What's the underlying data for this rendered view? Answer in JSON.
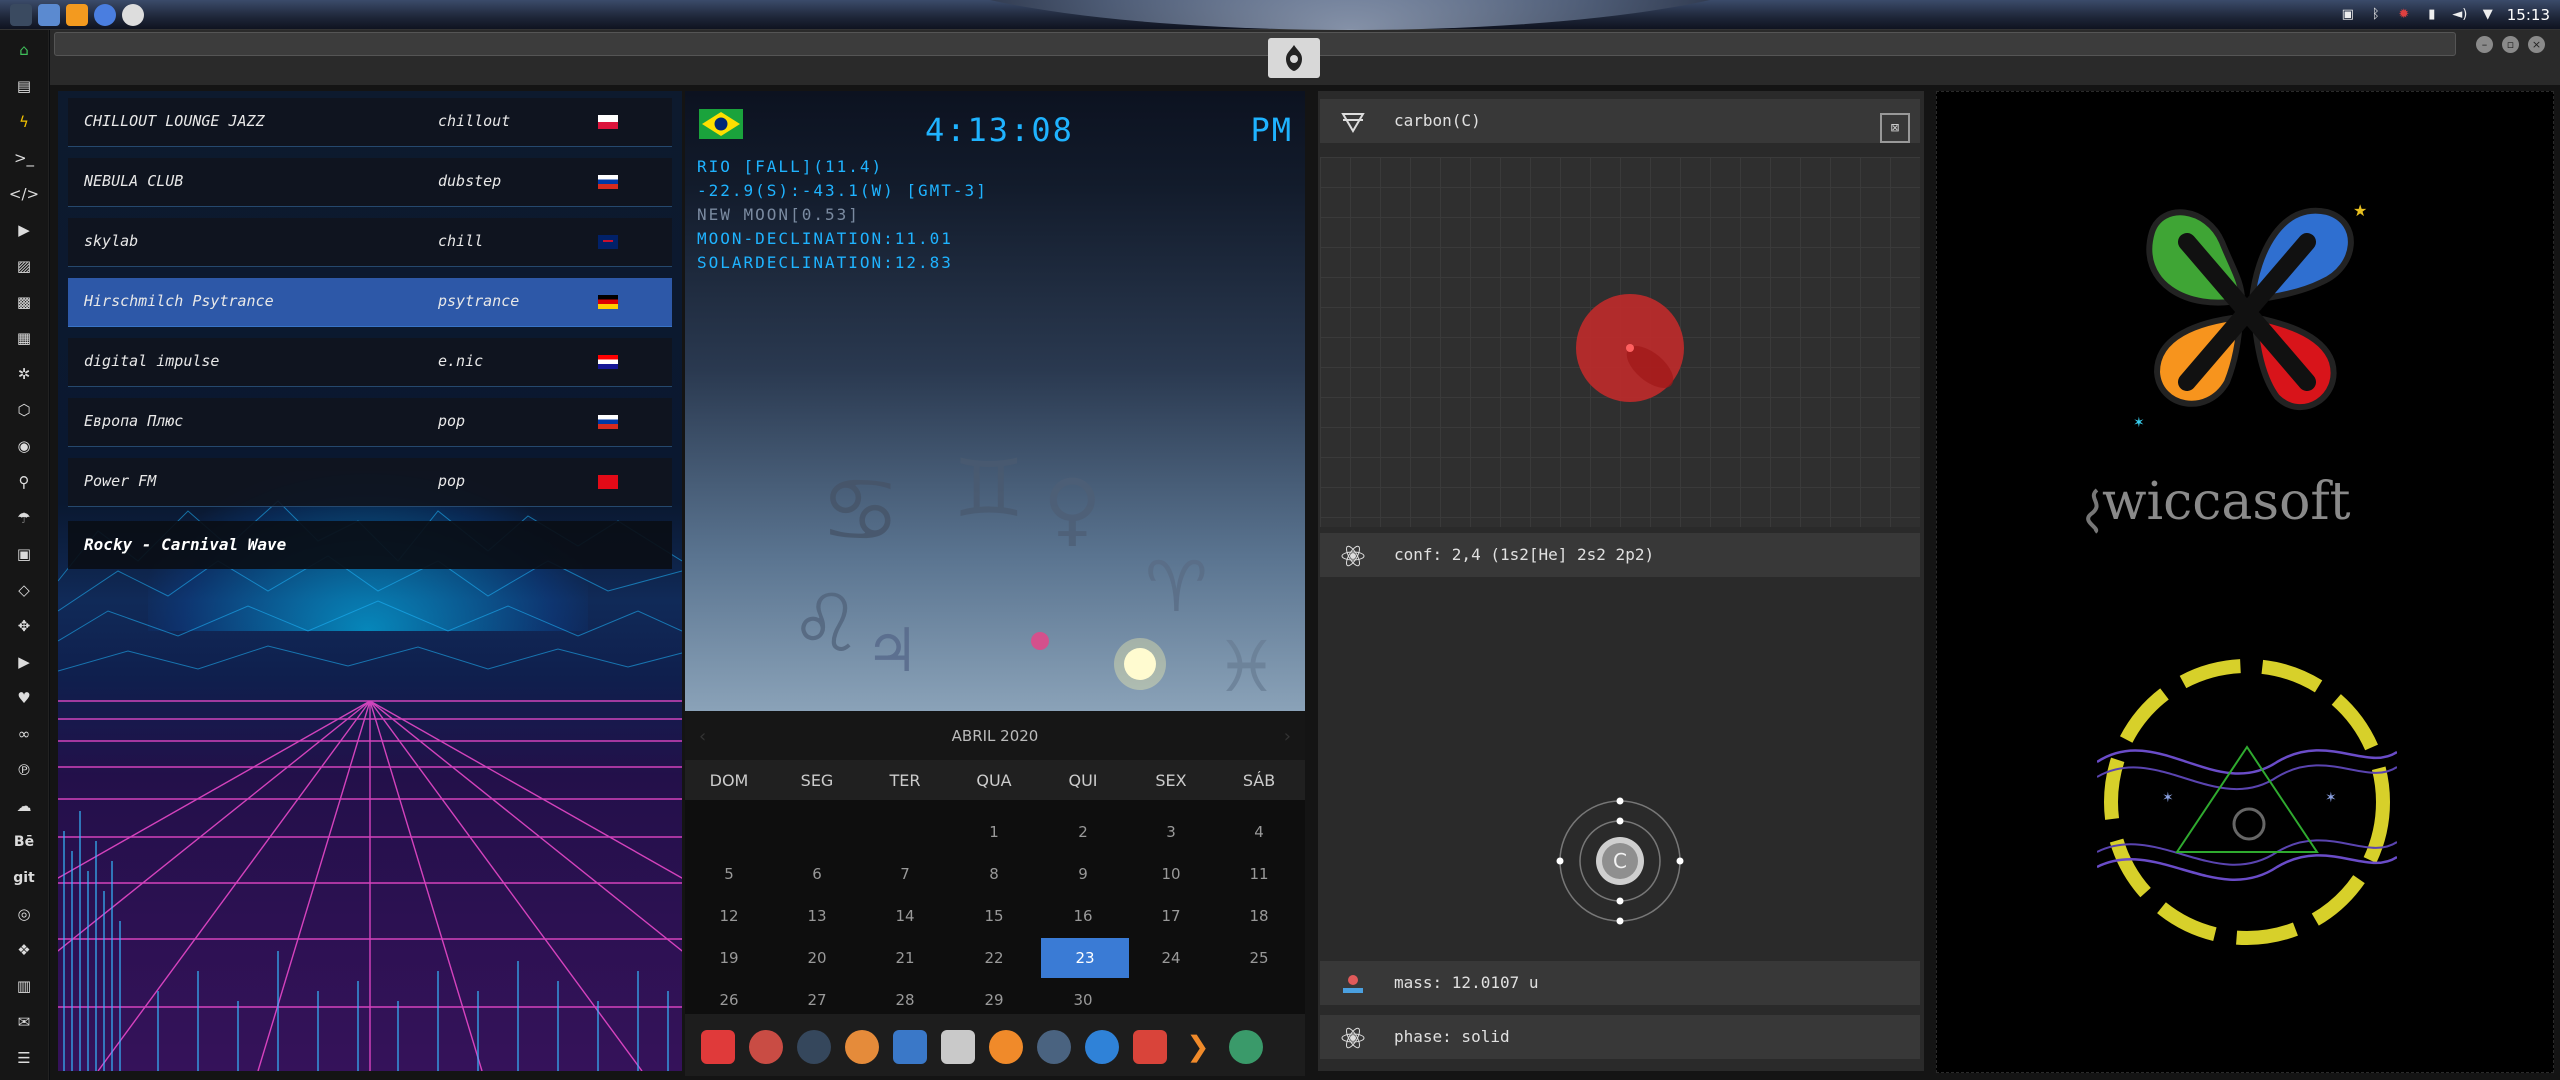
{
  "topbar": {
    "clock": "15:13",
    "apps": [
      "app-menu",
      "files",
      "sublime-text",
      "chrome",
      "steam"
    ],
    "tray": [
      "photo-icon",
      "bluetooth-icon",
      "bug-icon",
      "battery-icon",
      "volume-icon",
      "wifi-icon"
    ]
  },
  "leftdock": {
    "items": [
      "home",
      "document",
      "flash",
      "terminal",
      "code",
      "play",
      "image",
      "image",
      "news",
      "gear",
      "hex",
      "chrome",
      "search",
      "umbrella",
      "contacts",
      "tag",
      "move",
      "youtube",
      "heart",
      "link",
      "pinterest",
      "cloud",
      "Bē",
      "git",
      "github",
      "dropbox",
      "map",
      "mail",
      "server"
    ]
  },
  "radio": {
    "stations": [
      {
        "name": "CHILLOUT LOUNGE JAZZ",
        "genre": "chillout",
        "flag": "pl"
      },
      {
        "name": "NEBULA CLUB",
        "genre": "dubstep",
        "flag": "ru"
      },
      {
        "name": "skylab",
        "genre": "chill",
        "flag": "uk"
      },
      {
        "name": "Hirschmilch Psytrance",
        "genre": "psytrance",
        "flag": "de"
      },
      {
        "name": "digital impulse",
        "genre": "e.nic",
        "flag": "hr"
      },
      {
        "name": "Европа Плюс",
        "genre": "pop",
        "flag": "ru"
      },
      {
        "name": "Power FM",
        "genre": "pop",
        "flag": "tr"
      }
    ],
    "active_index": 3,
    "now_playing": "Rocky - Carnival Wave"
  },
  "sky": {
    "time": "4:13:08",
    "ampm": "PM",
    "lines": [
      "RIO [FALL](11.4)",
      "-22.9(S):-43.1(W) [GMT-3]",
      "NEW MOON[0.53]",
      "MOON-DECLINATION:11.01",
      "SOLARDECLINATION:12.83"
    ],
    "zodiac": [
      "♋",
      "♊",
      "♀",
      "♌",
      "♃",
      "♈",
      "♓"
    ]
  },
  "calendar": {
    "month": "ABRIL 2020",
    "daynames": [
      "DOM",
      "SEG",
      "TER",
      "QUA",
      "QUI",
      "SEX",
      "SÁB"
    ],
    "weeks": [
      [
        "",
        "",
        "",
        "1",
        "2",
        "3",
        "4"
      ],
      [
        "5",
        "6",
        "7",
        "8",
        "9",
        "10",
        "11"
      ],
      [
        "12",
        "13",
        "14",
        "15",
        "16",
        "17",
        "18"
      ],
      [
        "19",
        "20",
        "21",
        "22",
        "23",
        "24",
        "25"
      ],
      [
        "26",
        "27",
        "28",
        "29",
        "30",
        "",
        ""
      ]
    ],
    "today": "23"
  },
  "appdock": {
    "apps": [
      "anydesk",
      "hourglass",
      "globe",
      "photos",
      "translate",
      "news",
      "search",
      "clock",
      "web",
      "calendar",
      "arrow",
      "yandex"
    ]
  },
  "carbon": {
    "title": "carbon(C)",
    "conf": "conf: 2,4 (1s2[He] 2s2 2p2)",
    "symbol": "C",
    "mass": "mass: 12.0107 u",
    "phase": "phase: solid"
  },
  "wicca": {
    "brand": "wiccasoft"
  },
  "colors": {
    "accent": "#1fb3ff",
    "selected": "#2d58a8",
    "today": "#3a7bd5"
  }
}
